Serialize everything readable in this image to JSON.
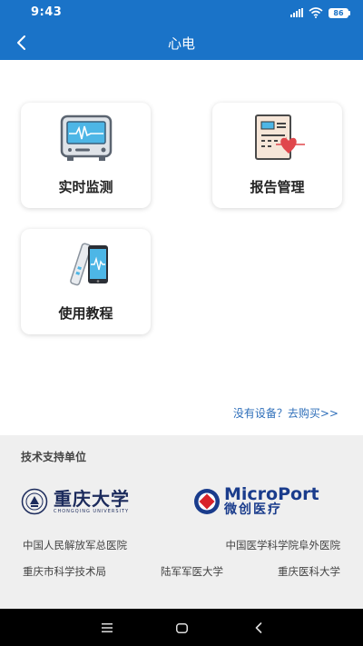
{
  "status_bar": {
    "time": "9:43",
    "battery": "86",
    "icons": [
      "signal-icon",
      "wifi-icon",
      "battery-icon"
    ]
  },
  "nav": {
    "title": "心电",
    "back_icon": "back-arrow-icon"
  },
  "menu": [
    {
      "label": "实时监测",
      "icon": "ecg-monitor-icon"
    },
    {
      "label": "报告管理",
      "icon": "report-heart-icon"
    },
    {
      "label": "使用教程",
      "icon": "phone-device-icon"
    }
  ],
  "buy_link": "没有设备？去购买>>",
  "support": {
    "title": "技术支持单位",
    "logos": {
      "chongqing_cn": "重庆大学",
      "chongqing_en": "CHONGQING UNIVERSITY",
      "microport_en": "MicroPort",
      "microport_cn": "微创医疗"
    },
    "rows": [
      [
        "中国人民解放军总医院",
        "中国医学科学院阜外医院"
      ],
      [
        "重庆市科学技术局",
        "陆军军医大学",
        "重庆医科大学"
      ]
    ]
  },
  "colors": {
    "primary": "#1a73c8",
    "link": "#2f6fba",
    "heart_red": "#e0474c"
  },
  "system_nav": [
    "menu-icon",
    "home-icon",
    "back-icon"
  ]
}
